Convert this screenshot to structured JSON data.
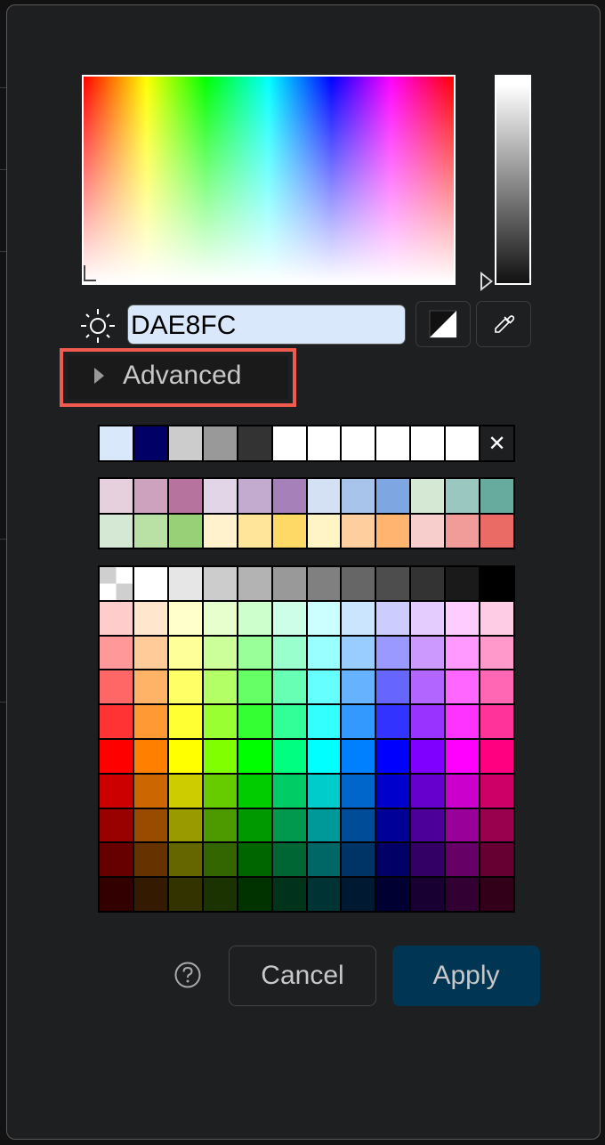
{
  "color_picker": {
    "hex_value": "DAE8FC",
    "selected_color": "#dae8fc",
    "advanced_label": "Advanced",
    "highlight_color": "#f05a4f"
  },
  "recent_colors": [
    "#dae8fc",
    "#000066",
    "#cccccc",
    "#999999",
    "#333333",
    "#ffffff",
    "#ffffff",
    "#ffffff",
    "#ffffff",
    "#ffffff",
    "#ffffff",
    "none"
  ],
  "preset_colors": [
    [
      "#e6d0de",
      "#cda2be",
      "#b5739d",
      "#e1d5e7",
      "#c3abd0",
      "#a680b8",
      "#d4e1f5",
      "#a9c4eb",
      "#7ea6e0",
      "#d5e8d4",
      "#9ac7bf",
      "#67ab9f"
    ],
    [
      "#d5e8d4",
      "#b9e0a5",
      "#97d077",
      "#fff2cc",
      "#ffe599",
      "#ffd966",
      "#fff4c3",
      "#ffce9f",
      "#ffb570",
      "#f8cecc",
      "#f19c99",
      "#ea6b66"
    ]
  ],
  "palette": [
    [
      "transparent",
      "#ffffff",
      "#e6e6e6",
      "#cccccc",
      "#b3b3b3",
      "#999999",
      "#808080",
      "#666666",
      "#4d4d4d",
      "#333333",
      "#1a1a1a",
      "#000000"
    ],
    [
      "#ffcccc",
      "#ffe6cc",
      "#ffffcc",
      "#e6ffcc",
      "#ccffcc",
      "#ccffe6",
      "#ccffff",
      "#cce5ff",
      "#ccccff",
      "#e5ccff",
      "#ffccff",
      "#ffcce6"
    ],
    [
      "#ff9999",
      "#ffcc99",
      "#ffff99",
      "#ccff99",
      "#99ff99",
      "#99ffcc",
      "#99ffff",
      "#99ccff",
      "#9999ff",
      "#cc99ff",
      "#ff99ff",
      "#ff99cc"
    ],
    [
      "#ff6666",
      "#ffb366",
      "#ffff66",
      "#b3ff66",
      "#66ff66",
      "#66ffb3",
      "#66ffff",
      "#66b2ff",
      "#6666ff",
      "#b266ff",
      "#ff66ff",
      "#ff66b3"
    ],
    [
      "#ff3333",
      "#ff9933",
      "#ffff33",
      "#99ff33",
      "#33ff33",
      "#33ff99",
      "#33ffff",
      "#3399ff",
      "#3333ff",
      "#9933ff",
      "#ff33ff",
      "#ff3399"
    ],
    [
      "#ff0000",
      "#ff8000",
      "#ffff00",
      "#80ff00",
      "#00ff00",
      "#00ff80",
      "#00ffff",
      "#007fff",
      "#0000ff",
      "#7f00ff",
      "#ff00ff",
      "#ff0080"
    ],
    [
      "#cc0000",
      "#cc6600",
      "#cccc00",
      "#66cc00",
      "#00cc00",
      "#00cc66",
      "#00cccc",
      "#0066cc",
      "#0000cc",
      "#6600cc",
      "#cc00cc",
      "#cc0066"
    ],
    [
      "#990000",
      "#994c00",
      "#999900",
      "#4d9900",
      "#009900",
      "#00994d",
      "#009999",
      "#004c99",
      "#000099",
      "#4c0099",
      "#990099",
      "#99004d"
    ],
    [
      "#660000",
      "#663300",
      "#666600",
      "#336600",
      "#006600",
      "#006633",
      "#006666",
      "#003366",
      "#000066",
      "#330066",
      "#660066",
      "#660033"
    ],
    [
      "#330000",
      "#331a00",
      "#333300",
      "#1a3300",
      "#003300",
      "#00331a",
      "#003333",
      "#001933",
      "#000033",
      "#190033",
      "#330033",
      "#33001a"
    ]
  ],
  "buttons": {
    "cancel_label": "Cancel",
    "apply_label": "Apply"
  },
  "icons": {
    "brightness": "sun-icon",
    "toggle_transparency": "contrast-icon",
    "eyedropper": "eyedropper-icon",
    "help": "help-icon",
    "clear": "close-icon"
  }
}
